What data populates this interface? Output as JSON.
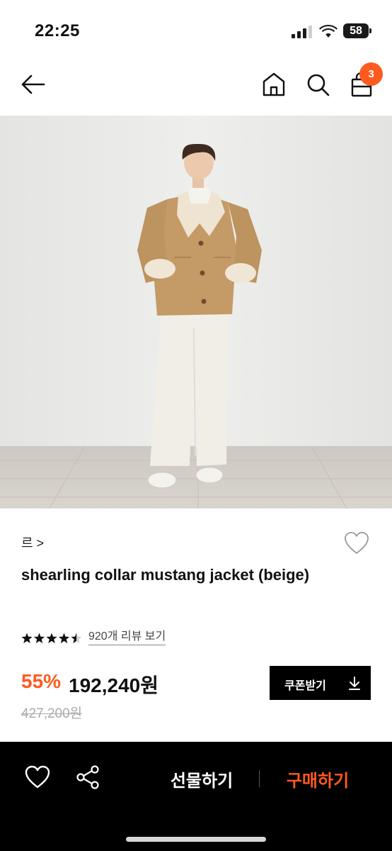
{
  "status_bar": {
    "time": "22:25",
    "battery": "58",
    "icons": [
      "signal-icon",
      "wifi-icon",
      "battery-icon"
    ]
  },
  "header": {
    "icons": [
      "back-arrow-icon",
      "home-icon",
      "search-icon",
      "shopping-bag-icon"
    ],
    "cart_count": "3"
  },
  "product": {
    "brand": "르 >",
    "title": "shearling collar mustang jacket (beige)",
    "rating": 4.5,
    "review_link": "920개 리뷰 보기",
    "discount_rate": "55%",
    "sale_price": "192,240원",
    "original_price": "427,200원",
    "coupon_button": "쿠폰받기"
  },
  "bottom_bar": {
    "gift_label": "선물하기",
    "buy_label": "구매하기",
    "icons": [
      "heart-icon",
      "share-icon"
    ]
  },
  "colors": {
    "accent": "#ff5a1f",
    "bottom_bar_bg": "#000000",
    "text_primary": "#111111",
    "text_muted": "#aaaaaa"
  }
}
